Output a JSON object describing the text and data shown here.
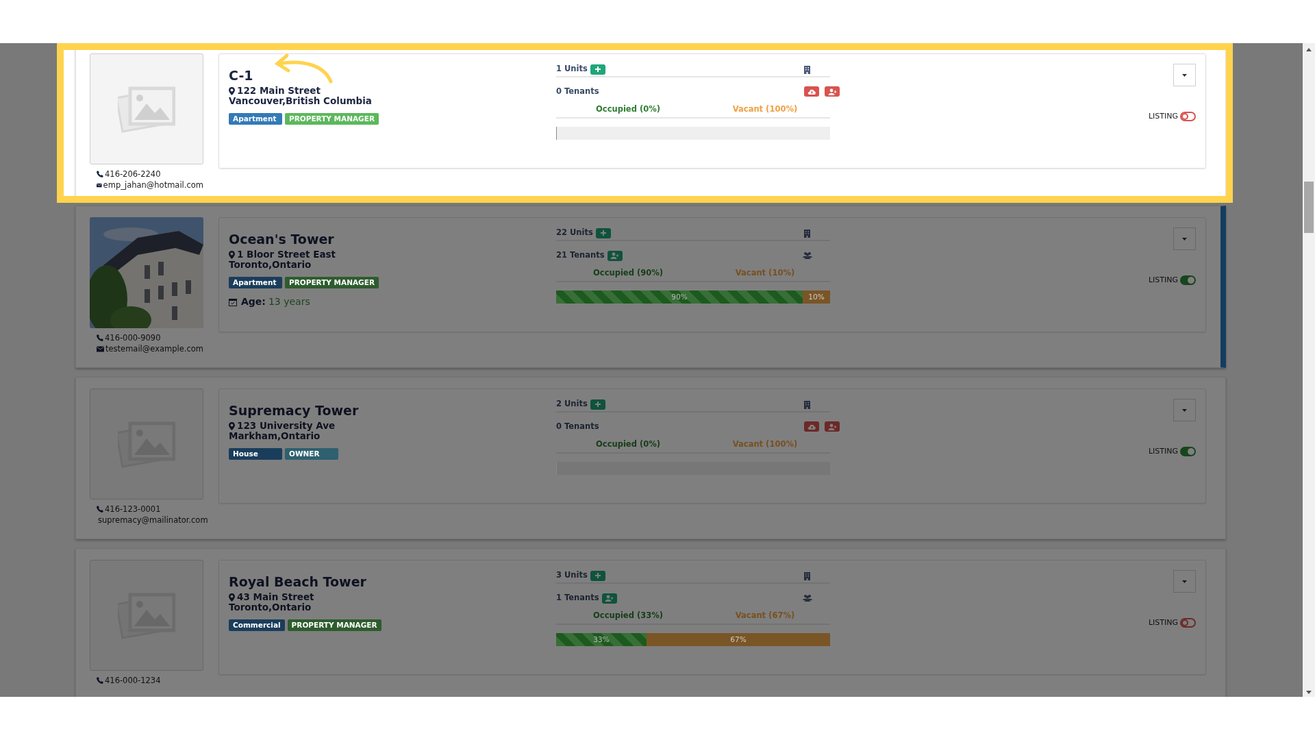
{
  "properties": [
    {
      "name": "C-1",
      "street": "122 Main Street",
      "city": "Vancouver,British Columbia",
      "tags": [
        {
          "label": "Apartment",
          "color": "#337ab7"
        },
        {
          "label": "PROPERTY MANAGER",
          "color": "#5cb85c"
        }
      ],
      "phone": "416-206-2240",
      "email": "emp_jahan@hotmail.com",
      "has_photo": false,
      "units": "1 Units",
      "tenants": "0 Tenants",
      "has_tenants": false,
      "occupied": "Occupied (0%)",
      "vacant": "Vacant (100%)",
      "listing": {
        "label": "LISTING",
        "on": false
      },
      "highlighted": true,
      "selected": false
    },
    {
      "name": "Ocean's Tower",
      "street": "1 Bloor Street East",
      "city": "Toronto,Ontario",
      "tags": [
        {
          "label": "Apartment",
          "color": "#1a3d5c"
        },
        {
          "label": "PROPERTY MANAGER",
          "color": "#2e5c2e"
        }
      ],
      "age_label": "Age:",
      "age": "13 years",
      "phone": "416-000-9090",
      "email": "testemail@example.com",
      "has_photo": true,
      "units": "22 Units",
      "tenants": "21 Tenants",
      "has_tenants": true,
      "occupied": "Occupied (90%)",
      "vacant": "Vacant (10%)",
      "bar": {
        "level": 0.9,
        "occupied_label": "90%",
        "vacant_label": "10%"
      },
      "listing": {
        "label": "LISTING",
        "on": true
      },
      "highlighted": false,
      "selected": true
    },
    {
      "name": "Supremacy Tower",
      "street": "123 University Ave",
      "city": "Markham,Ontario",
      "tags": [
        {
          "label": "House",
          "color": "#1a3d5c"
        },
        {
          "label": "OWNER",
          "color": "#2e606f"
        }
      ],
      "phone": "416-123-0001",
      "email": "supremacy@mailinator.com",
      "has_photo": false,
      "units": "2 Units",
      "tenants": "0 Tenants",
      "has_tenants": false,
      "occupied": "Occupied (0%)",
      "vacant": "Vacant (100%)",
      "listing": {
        "label": "LISTING",
        "on": true
      },
      "highlighted": false,
      "selected": false
    },
    {
      "name": "Royal Beach Tower",
      "street": "43 Main Street",
      "city": "Toronto,Ontario",
      "tags": [
        {
          "label": "Commercial",
          "color": "#1a3d5c"
        },
        {
          "label": "PROPERTY MANAGER",
          "color": "#2e5c2e"
        }
      ],
      "phone": "416-000-1234",
      "has_photo": false,
      "units": "3 Units",
      "tenants": "1 Tenants",
      "has_tenants": true,
      "occupied": "Occupied (33%)",
      "vacant": "Vacant (67%)",
      "bar": {
        "level": 0.33,
        "occupied_label": "33%",
        "vacant_label": "67%"
      },
      "listing": {
        "label": "LISTING",
        "on": false
      },
      "highlighted": false,
      "selected": false
    }
  ]
}
